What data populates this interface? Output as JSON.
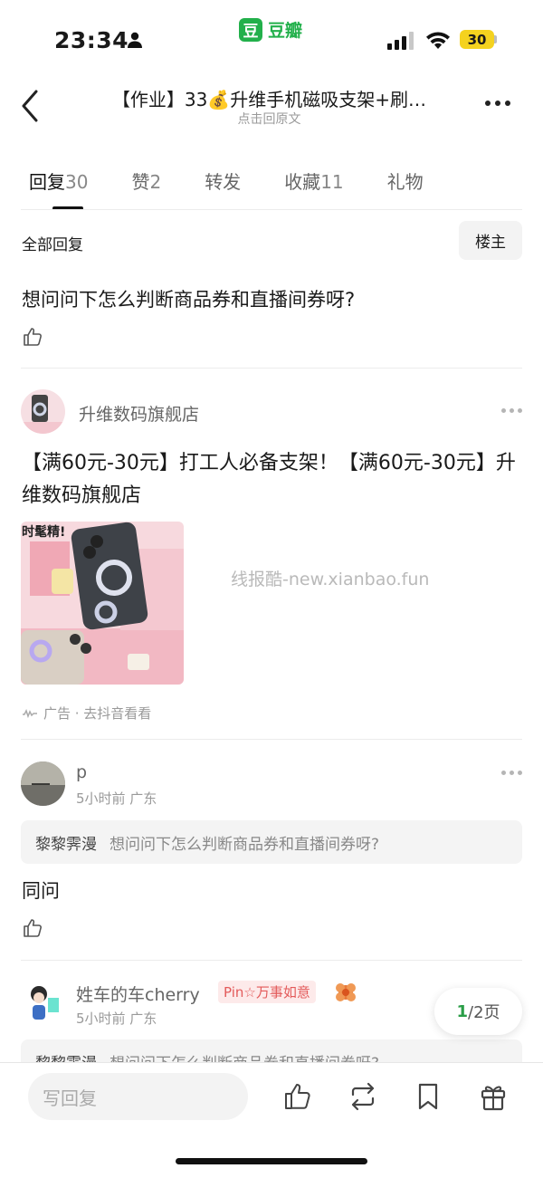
{
  "status_bar": {
    "time": "23:34",
    "battery": "30"
  },
  "app": {
    "glyph": "豆",
    "name": "豆瓣"
  },
  "header": {
    "title": "【作业】33💰升维手机磁吸支架+刷…",
    "subtitle": "点击回原文"
  },
  "tabs": [
    {
      "label": "回复",
      "count": "30"
    },
    {
      "label": "赞",
      "count": "2"
    },
    {
      "label": "转发",
      "count": ""
    },
    {
      "label": "收藏",
      "count": "11"
    },
    {
      "label": "礼物",
      "count": ""
    }
  ],
  "filter": {
    "all_replies": "全部回复",
    "op_only": "楼主"
  },
  "question": {
    "text": "想问问下怎么判断商品券和直播间券呀?"
  },
  "ad": {
    "shop_name": "升维数码旗舰店",
    "text": "【满60元-30元】打工人必备支架！【满60元-30元】升维数码旗舰店",
    "image_caption": "时髦精!",
    "meta": "广告 · 去抖音看看"
  },
  "watermark": "线报酷-new.xianbao.fun",
  "comments": [
    {
      "author": "p",
      "time_location": "5小时前 广东",
      "quote_name": "黎黎霁漫",
      "quote_text": "想问问下怎么判断商品券和直播间券呀?",
      "body": "同问"
    },
    {
      "author": "姓车的车cherry",
      "badge": "Pin☆万事如意",
      "time_location": "5小时前 广东",
      "quote_name": "黎黎霁漫",
      "quote_text": "想问问下怎么判断商品券和直播间券呀?"
    }
  ],
  "pager": {
    "current": "1",
    "rest": "/2页"
  },
  "bottom_bar": {
    "reply_placeholder": "写回复"
  },
  "colors": {
    "accent_green": "#22b04b",
    "battery_yellow": "#f4d21f",
    "badge_red": "#e35a5a"
  }
}
